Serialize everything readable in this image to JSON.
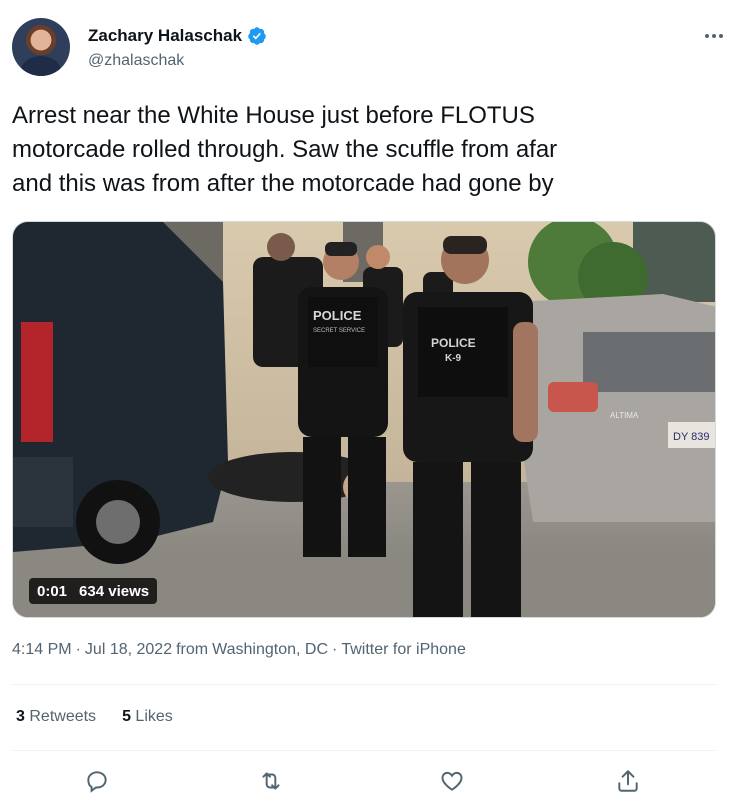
{
  "author": {
    "name": "Zachary Halaschak",
    "handle": "@zhalaschak",
    "verified": true,
    "avatar_icon": "user-avatar"
  },
  "tweet": {
    "text": "Arrest near the White House just before FLOTUS\nmotorcade rolled through. Saw the scuffle from afar\nand this was from after the motorcade had gone by"
  },
  "media": {
    "type": "video",
    "duration": "0:01",
    "views": "634 views",
    "vest_label_1": "POLICE",
    "vest_label_1_sub": "SECRET SERVICE",
    "vest_label_2": "POLICE",
    "vest_label_2_sub": "K-9",
    "car_badge": "ALTIMA",
    "plate": "DY 839"
  },
  "meta": {
    "time": "4:14 PM",
    "date": "Jul 18, 2022",
    "from_word": "from",
    "location": "Washington, DC",
    "source": "Twitter for iPhone",
    "separator": "·"
  },
  "stats": {
    "retweets_count": "3",
    "retweets_label": "Retweets",
    "likes_count": "5",
    "likes_label": "Likes"
  },
  "colors": {
    "accent": "#1d9bf0",
    "text_primary": "#0f1419",
    "text_secondary": "#536471",
    "divider": "#eff3f4"
  }
}
